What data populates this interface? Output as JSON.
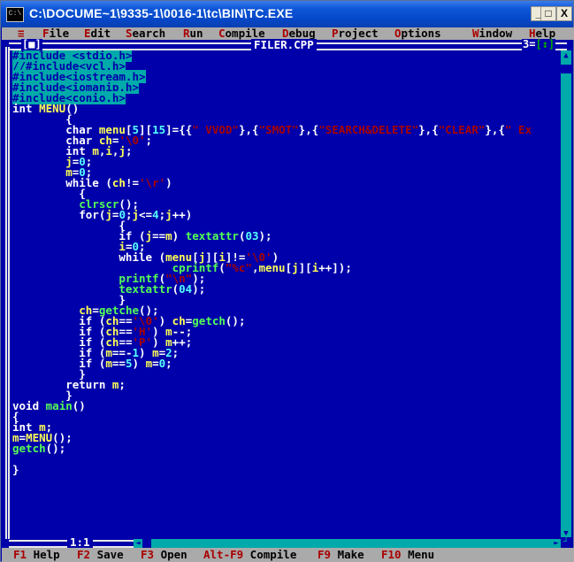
{
  "window": {
    "title": "C:\\DOCUME~1\\9335-1\\0016-1\\tc\\BIN\\TC.EXE",
    "icon_text": "C:\\",
    "buttons": {
      "minimize": "_",
      "maximize": "□",
      "close": "X"
    }
  },
  "menu": [
    {
      "hotkey": "≡",
      "rest": ""
    },
    {
      "hotkey": "F",
      "rest": "ile"
    },
    {
      "hotkey": "E",
      "rest": "dit"
    },
    {
      "hotkey": "S",
      "rest": "earch"
    },
    {
      "hotkey": "R",
      "rest": "un"
    },
    {
      "hotkey": "C",
      "rest": "ompile"
    },
    {
      "hotkey": "D",
      "rest": "ebug"
    },
    {
      "hotkey": "P",
      "rest": "roject"
    },
    {
      "hotkey": "O",
      "rest": "ptions"
    },
    {
      "hotkey": "W",
      "rest": "indow"
    },
    {
      "hotkey": "H",
      "rest": "elp"
    }
  ],
  "editor": {
    "filename": "FILER.CPP",
    "close_box": "[■]",
    "window_number": "3",
    "zoom_box": "[↕]",
    "cursor_pos": "1:1"
  },
  "code_lines": [
    [
      {
        "t": "#include <stdio.h>",
        "c": "pp"
      }
    ],
    [
      {
        "t": "//#include<vcl.h>",
        "c": "cm"
      }
    ],
    [
      {
        "t": "#include<iostream.h>",
        "c": "pp"
      }
    ],
    [
      {
        "t": "#include<iomanip.h>",
        "c": "pp"
      }
    ],
    [
      {
        "t": "#include<conio.h>",
        "c": "pp"
      }
    ],
    [
      {
        "t": "int ",
        "c": "kw"
      },
      {
        "t": "MENU",
        "c": "id"
      },
      {
        "t": "()",
        "c": "sy"
      }
    ],
    [
      {
        "t": "        {",
        "c": "sy"
      }
    ],
    [
      {
        "t": "        char ",
        "c": "kw"
      },
      {
        "t": "menu",
        "c": "id"
      },
      {
        "t": "[",
        "c": "sy"
      },
      {
        "t": "5",
        "c": "nu"
      },
      {
        "t": "][",
        "c": "sy"
      },
      {
        "t": "15",
        "c": "nu"
      },
      {
        "t": "]={{",
        "c": "sy"
      },
      {
        "t": "\" VVOD\"",
        "c": "st"
      },
      {
        "t": "},{",
        "c": "sy"
      },
      {
        "t": "\"SMOT\"",
        "c": "st"
      },
      {
        "t": "},{",
        "c": "sy"
      },
      {
        "t": "\"SEARCH&DELETE\"",
        "c": "st"
      },
      {
        "t": "},{",
        "c": "sy"
      },
      {
        "t": "\"CLEAR\"",
        "c": "st"
      },
      {
        "t": "},{",
        "c": "sy"
      },
      {
        "t": "\" Ex",
        "c": "st"
      }
    ],
    [
      {
        "t": "        char ",
        "c": "kw"
      },
      {
        "t": "ch",
        "c": "id"
      },
      {
        "t": "=",
        "c": "sy"
      },
      {
        "t": "'\\0'",
        "c": "st"
      },
      {
        "t": ";",
        "c": "sy"
      }
    ],
    [
      {
        "t": "        int ",
        "c": "kw"
      },
      {
        "t": "m",
        "c": "id"
      },
      {
        "t": ",",
        "c": "sy"
      },
      {
        "t": "i",
        "c": "id"
      },
      {
        "t": ",",
        "c": "sy"
      },
      {
        "t": "j",
        "c": "id"
      },
      {
        "t": ";",
        "c": "sy"
      }
    ],
    [
      {
        "t": "        j",
        "c": "id"
      },
      {
        "t": "=",
        "c": "sy"
      },
      {
        "t": "0",
        "c": "nu"
      },
      {
        "t": ";",
        "c": "sy"
      }
    ],
    [
      {
        "t": "        m",
        "c": "id"
      },
      {
        "t": "=",
        "c": "sy"
      },
      {
        "t": "0",
        "c": "nu"
      },
      {
        "t": ";",
        "c": "sy"
      }
    ],
    [
      {
        "t": "        while ",
        "c": "kw"
      },
      {
        "t": "(",
        "c": "sy"
      },
      {
        "t": "ch",
        "c": "id"
      },
      {
        "t": "!=",
        "c": "sy"
      },
      {
        "t": "'\\r'",
        "c": "st"
      },
      {
        "t": ")",
        "c": "sy"
      }
    ],
    [
      {
        "t": "          {",
        "c": "sy"
      }
    ],
    [
      {
        "t": "          clrscr",
        "c": "fn"
      },
      {
        "t": "();",
        "c": "sy"
      }
    ],
    [
      {
        "t": "          for",
        "c": "kw"
      },
      {
        "t": "(",
        "c": "sy"
      },
      {
        "t": "j",
        "c": "id"
      },
      {
        "t": "=",
        "c": "sy"
      },
      {
        "t": "0",
        "c": "nu"
      },
      {
        "t": ";",
        "c": "sy"
      },
      {
        "t": "j",
        "c": "id"
      },
      {
        "t": "<=",
        "c": "sy"
      },
      {
        "t": "4",
        "c": "nu"
      },
      {
        "t": ";",
        "c": "sy"
      },
      {
        "t": "j",
        "c": "id"
      },
      {
        "t": "++)",
        "c": "sy"
      }
    ],
    [
      {
        "t": "                {",
        "c": "sy"
      }
    ],
    [
      {
        "t": "                if ",
        "c": "kw"
      },
      {
        "t": "(",
        "c": "sy"
      },
      {
        "t": "j",
        "c": "id"
      },
      {
        "t": "==",
        "c": "sy"
      },
      {
        "t": "m",
        "c": "id"
      },
      {
        "t": ") ",
        "c": "sy"
      },
      {
        "t": "textattr",
        "c": "fn"
      },
      {
        "t": "(",
        "c": "sy"
      },
      {
        "t": "03",
        "c": "nu"
      },
      {
        "t": ");",
        "c": "sy"
      }
    ],
    [
      {
        "t": "                i",
        "c": "id"
      },
      {
        "t": "=",
        "c": "sy"
      },
      {
        "t": "0",
        "c": "nu"
      },
      {
        "t": ";",
        "c": "sy"
      }
    ],
    [
      {
        "t": "                while ",
        "c": "kw"
      },
      {
        "t": "(",
        "c": "sy"
      },
      {
        "t": "menu",
        "c": "id"
      },
      {
        "t": "[",
        "c": "sy"
      },
      {
        "t": "j",
        "c": "id"
      },
      {
        "t": "][",
        "c": "sy"
      },
      {
        "t": "i",
        "c": "id"
      },
      {
        "t": "]!=",
        "c": "sy"
      },
      {
        "t": "'\\0'",
        "c": "st"
      },
      {
        "t": ")",
        "c": "sy"
      }
    ],
    [
      {
        "t": "                        cprintf",
        "c": "fn"
      },
      {
        "t": "(",
        "c": "sy"
      },
      {
        "t": "\"%c\"",
        "c": "st"
      },
      {
        "t": ",",
        "c": "sy"
      },
      {
        "t": "menu",
        "c": "id"
      },
      {
        "t": "[",
        "c": "sy"
      },
      {
        "t": "j",
        "c": "id"
      },
      {
        "t": "][",
        "c": "sy"
      },
      {
        "t": "i",
        "c": "id"
      },
      {
        "t": "++]);",
        "c": "sy"
      }
    ],
    [
      {
        "t": "                printf",
        "c": "fn"
      },
      {
        "t": "(",
        "c": "sy"
      },
      {
        "t": "\"\\n\"",
        "c": "st"
      },
      {
        "t": ");",
        "c": "sy"
      }
    ],
    [
      {
        "t": "                textattr",
        "c": "fn"
      },
      {
        "t": "(",
        "c": "sy"
      },
      {
        "t": "04",
        "c": "nu"
      },
      {
        "t": ");",
        "c": "sy"
      }
    ],
    [
      {
        "t": "                }",
        "c": "sy"
      }
    ],
    [
      {
        "t": "          ch",
        "c": "id"
      },
      {
        "t": "=",
        "c": "sy"
      },
      {
        "t": "getche",
        "c": "fn"
      },
      {
        "t": "();",
        "c": "sy"
      }
    ],
    [
      {
        "t": "          if ",
        "c": "kw"
      },
      {
        "t": "(",
        "c": "sy"
      },
      {
        "t": "ch",
        "c": "id"
      },
      {
        "t": "==",
        "c": "sy"
      },
      {
        "t": "'\\0'",
        "c": "st"
      },
      {
        "t": ") ",
        "c": "sy"
      },
      {
        "t": "ch",
        "c": "id"
      },
      {
        "t": "=",
        "c": "sy"
      },
      {
        "t": "getch",
        "c": "fn"
      },
      {
        "t": "();",
        "c": "sy"
      }
    ],
    [
      {
        "t": "          if ",
        "c": "kw"
      },
      {
        "t": "(",
        "c": "sy"
      },
      {
        "t": "ch",
        "c": "id"
      },
      {
        "t": "==",
        "c": "sy"
      },
      {
        "t": "'H'",
        "c": "st"
      },
      {
        "t": ") ",
        "c": "sy"
      },
      {
        "t": "m",
        "c": "id"
      },
      {
        "t": "--;",
        "c": "sy"
      }
    ],
    [
      {
        "t": "          if ",
        "c": "kw"
      },
      {
        "t": "(",
        "c": "sy"
      },
      {
        "t": "ch",
        "c": "id"
      },
      {
        "t": "==",
        "c": "sy"
      },
      {
        "t": "'P'",
        "c": "st"
      },
      {
        "t": ") ",
        "c": "sy"
      },
      {
        "t": "m",
        "c": "id"
      },
      {
        "t": "++;",
        "c": "sy"
      }
    ],
    [
      {
        "t": "          if ",
        "c": "kw"
      },
      {
        "t": "(",
        "c": "sy"
      },
      {
        "t": "m",
        "c": "id"
      },
      {
        "t": "==-",
        "c": "sy"
      },
      {
        "t": "1",
        "c": "nu"
      },
      {
        "t": ") ",
        "c": "sy"
      },
      {
        "t": "m",
        "c": "id"
      },
      {
        "t": "=",
        "c": "sy"
      },
      {
        "t": "2",
        "c": "nu"
      },
      {
        "t": ";",
        "c": "sy"
      }
    ],
    [
      {
        "t": "          if ",
        "c": "kw"
      },
      {
        "t": "(",
        "c": "sy"
      },
      {
        "t": "m",
        "c": "id"
      },
      {
        "t": "==",
        "c": "sy"
      },
      {
        "t": "5",
        "c": "nu"
      },
      {
        "t": ") ",
        "c": "sy"
      },
      {
        "t": "m",
        "c": "id"
      },
      {
        "t": "=",
        "c": "sy"
      },
      {
        "t": "0",
        "c": "nu"
      },
      {
        "t": ";",
        "c": "sy"
      }
    ],
    [
      {
        "t": "          }",
        "c": "sy"
      }
    ],
    [
      {
        "t": "        return ",
        "c": "kw"
      },
      {
        "t": "m",
        "c": "id"
      },
      {
        "t": ";",
        "c": "sy"
      }
    ],
    [
      {
        "t": "        }",
        "c": "sy"
      }
    ],
    [
      {
        "t": "void ",
        "c": "kw"
      },
      {
        "t": "main",
        "c": "fn"
      },
      {
        "t": "()",
        "c": "sy"
      }
    ],
    [
      {
        "t": "{",
        "c": "sy"
      }
    ],
    [
      {
        "t": "int ",
        "c": "kw"
      },
      {
        "t": "m",
        "c": "id"
      },
      {
        "t": ";",
        "c": "sy"
      }
    ],
    [
      {
        "t": "m",
        "c": "id"
      },
      {
        "t": "=",
        "c": "sy"
      },
      {
        "t": "MENU",
        "c": "id"
      },
      {
        "t": "();",
        "c": "sy"
      }
    ],
    [
      {
        "t": "getch",
        "c": "fn"
      },
      {
        "t": "();",
        "c": "sy"
      }
    ],
    [
      {
        "t": "",
        "c": "sy"
      }
    ],
    [
      {
        "t": "}",
        "c": "sy"
      }
    ]
  ],
  "status_bar": [
    {
      "key": "F1",
      "label": " Help"
    },
    {
      "key": "F2",
      "label": " Save"
    },
    {
      "key": "F3",
      "label": " Open"
    },
    {
      "key": "Alt-F9",
      "label": " Compile"
    },
    {
      "key": "F9",
      "label": " Make"
    },
    {
      "key": "F10",
      "label": " Menu"
    }
  ],
  "colors": {
    "editor_bg": "#0000aa",
    "menu_bg": "#aaaaaa",
    "hotkey": "#aa0000",
    "identifier": "#ffff55",
    "string": "#aa0000",
    "function": "#55ff55",
    "preprocessor_bg": "#00aaaa"
  }
}
